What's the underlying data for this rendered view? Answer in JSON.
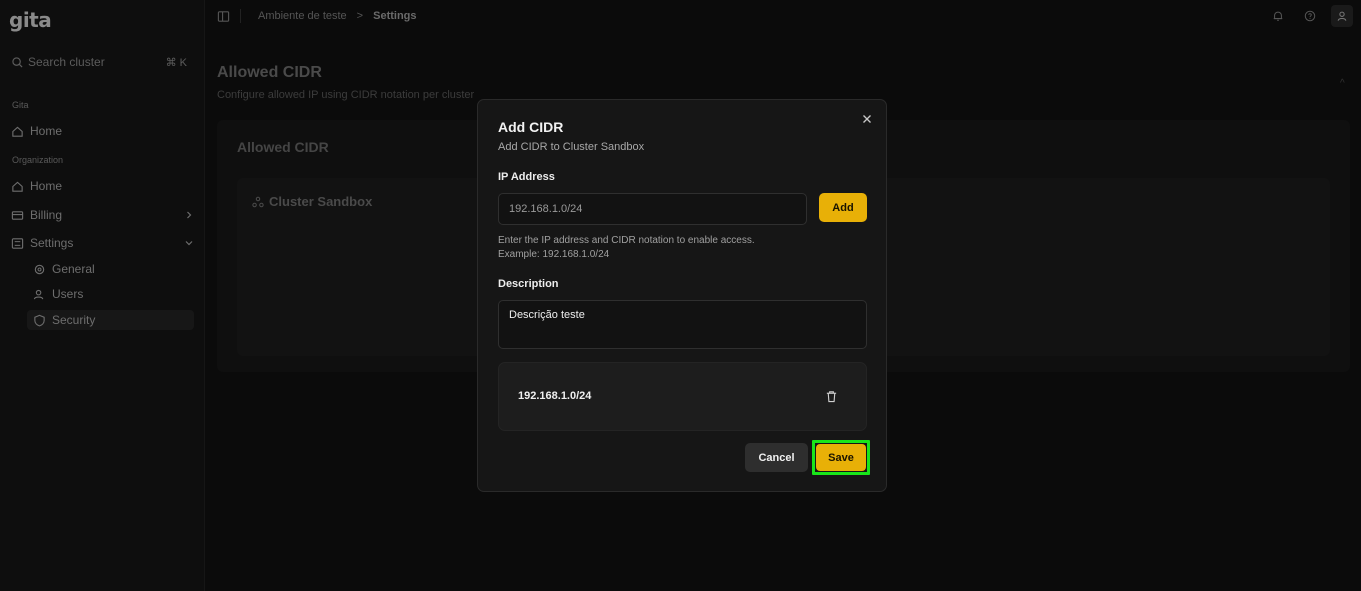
{
  "app": {
    "logo": "gita"
  },
  "sidebar": {
    "search_placeholder": "Search cluster",
    "search_shortcut": "⌘ K",
    "sections": {
      "gita_label": "Gita",
      "org_label": "Organization"
    },
    "items": {
      "gita_home": "Home",
      "org_home": "Home",
      "billing": "Billing",
      "settings": "Settings",
      "general": "General",
      "users": "Users",
      "security": "Security"
    }
  },
  "breadcrumb": {
    "env": "Ambiente de teste",
    "separator": ">",
    "current": "Settings"
  },
  "page": {
    "title": "Allowed CIDR",
    "subtitle": "Configure allowed IP using CIDR notation per cluster",
    "card_title": "Allowed CIDR",
    "cluster_title": "Cluster Sandbox"
  },
  "modal": {
    "title": "Add CIDR",
    "subtitle": "Add CIDR to Cluster Sandbox",
    "ip_label": "IP Address",
    "ip_value": "192.168.1.0/24",
    "add_label": "Add",
    "hint_line1": "Enter the IP address and CIDR notation to enable access.",
    "hint_line2": "Example: 192.168.1.0/24",
    "desc_label": "Description",
    "desc_value": "Descrição teste",
    "cidr_items": [
      "192.168.1.0/24"
    ],
    "cancel_label": "Cancel",
    "save_label": "Save"
  },
  "colors": {
    "accent": "#e8b007",
    "highlight": "#19e61a"
  }
}
